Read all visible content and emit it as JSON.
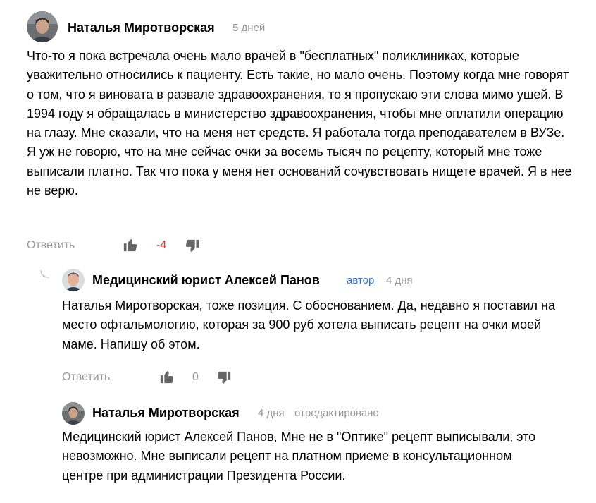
{
  "comments": [
    {
      "author": "Наталья Миротворская",
      "time": "5 дней",
      "text": "Что-то я пока встречала очень мало врачей в \"бесплатных\" поликлиниках, которые уважительно относились к пациенту. Есть такие, но мало очень. Поэтому когда мне говорят о том, что я виновата в развале здравоохранения, то я пропускаю эти слова мимо ушей. В 1994 году я обращалась в министерство здравоохранения, чтобы мне оплатили операцию на глазу. Мне сказали, что на меня нет средств. Я работала тогда преподавателем в ВУЗе. Я уж не говорю, что на мне сейчас очки за восемь тысяч по рецепту, который мне тоже выписали платно. Так что пока у меня нет оснований сочувствовать нищете врачей. Я в нее не верю.",
      "reply_label": "Ответить",
      "score": "-4"
    },
    {
      "author": "Медицинский юрист Алексей Панов",
      "badge": "автор",
      "time": "4 дня",
      "text": "Наталья Миротворская, тоже позиция. С обоснованием. Да, недавно я поставил на место офтальмологию, которая за 900 руб хотела выписать рецепт на очки моей маме. Напишу об этом.",
      "reply_label": "Ответить",
      "score": "0"
    },
    {
      "author": "Наталья Миротворская",
      "time": "4 дня",
      "edited": "отредактировано",
      "text": "Медицинский юрист Алексей Панов, Мне не в \"Оптике\" рецепт выписывали, это невозможно. Мне выписали рецепт на платном приеме в консультационном центре при администрации Президента России."
    }
  ],
  "icons": {
    "like": "thumbs-up-icon",
    "dislike": "thumbs-down-icon",
    "thread": "reply-thread-icon"
  },
  "colors": {
    "meta": "#999999",
    "author_badge": "#2f6fd6",
    "negative_score": "#e62e2e"
  }
}
